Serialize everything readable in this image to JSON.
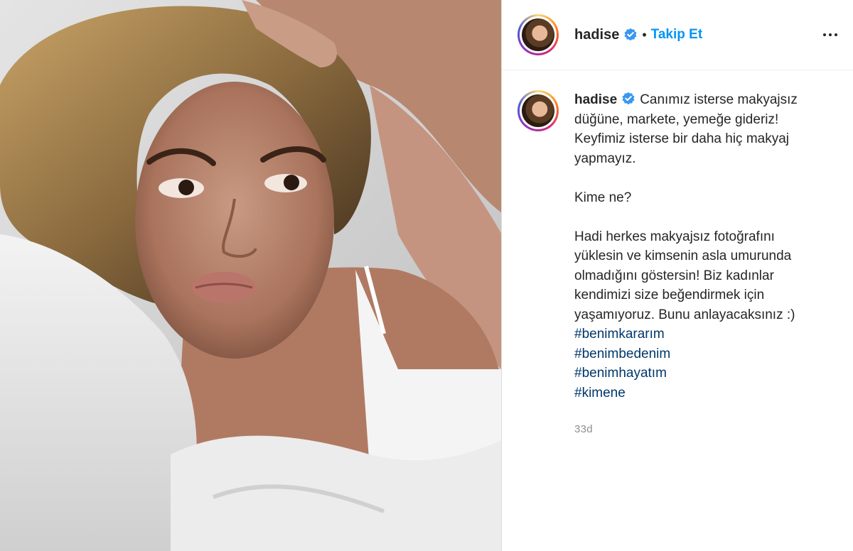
{
  "header": {
    "username": "hadise",
    "verified_icon": "verified-badge-icon",
    "separator": "•",
    "follow_label": "Takip Et",
    "more_icon": "more-options-icon"
  },
  "caption": {
    "username": "hadise",
    "lines": [
      "Canımız isterse makyajsız",
      "düğüne, markete, yemeğe gideriz!",
      "Keyfimiz isterse bir daha hiç makyaj",
      "yapmayız."
    ],
    "line2": "Kime ne?",
    "para3": [
      "Hadi herkes makyajsız fotoğrafını",
      "yüklesin ve kimsenin asla umurunda",
      "olmadığını göstersin! Biz kadınlar",
      "kendimizi size beğendirmek için",
      "yaşamıyoruz. Bunu anlayacaksınız :)"
    ],
    "hashtags": [
      "#benimkararım",
      "#benimbedenim",
      "#benimhayatım",
      "#kimene"
    ],
    "time": "33d"
  },
  "colors": {
    "link_blue": "#0095f6",
    "hashtag": "#00376b",
    "verified": "#3897f0",
    "muted": "#8e8e8e"
  }
}
